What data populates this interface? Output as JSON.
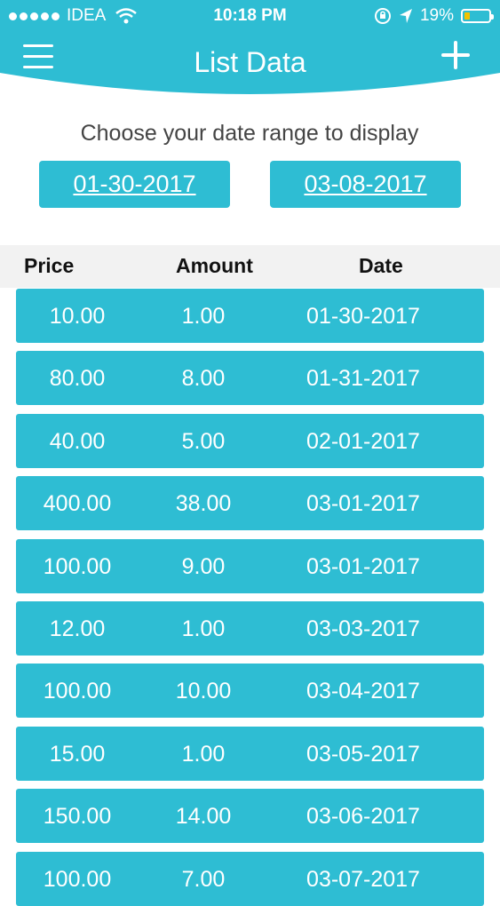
{
  "status_bar": {
    "carrier": "IDEA",
    "time": "10:18 PM",
    "battery_percent": "19%",
    "icons": [
      "signal-dots-icon",
      "wifi-icon",
      "orientation-lock-icon",
      "location-arrow-icon",
      "battery-icon"
    ]
  },
  "nav": {
    "title": "List Data",
    "menu_icon": "hamburger-menu-icon",
    "add_icon": "plus-icon"
  },
  "date_range": {
    "prompt": "Choose your date range to display",
    "start": "01-30-2017",
    "end": "03-08-2017"
  },
  "table": {
    "columns": [
      "Price",
      "Amount",
      "Date"
    ],
    "rows": [
      {
        "price": "10.00",
        "amount": "1.00",
        "date": "01-30-2017"
      },
      {
        "price": "80.00",
        "amount": "8.00",
        "date": "01-31-2017"
      },
      {
        "price": "40.00",
        "amount": "5.00",
        "date": "02-01-2017"
      },
      {
        "price": "400.00",
        "amount": "38.00",
        "date": "03-01-2017"
      },
      {
        "price": "100.00",
        "amount": "9.00",
        "date": "03-01-2017"
      },
      {
        "price": "12.00",
        "amount": "1.00",
        "date": "03-03-2017"
      },
      {
        "price": "100.00",
        "amount": "10.00",
        "date": "03-04-2017"
      },
      {
        "price": "15.00",
        "amount": "1.00",
        "date": "03-05-2017"
      },
      {
        "price": "150.00",
        "amount": "14.00",
        "date": "03-06-2017"
      },
      {
        "price": "100.00",
        "amount": "7.00",
        "date": "03-07-2017"
      }
    ]
  },
  "colors": {
    "accent": "#2ebdd3",
    "header_bg": "#2ebdd3",
    "battery_fill": "#f3c200"
  }
}
